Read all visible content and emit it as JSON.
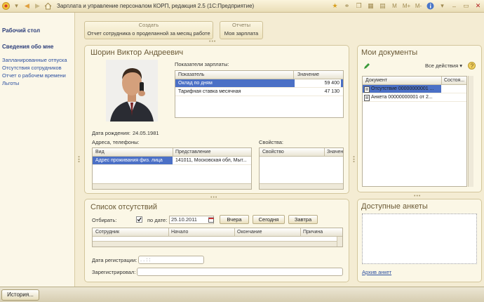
{
  "window": {
    "title": "Зарплата и управление персоналом КОРП, редакция 2.5  (1С:Предприятие)"
  },
  "sidebar": {
    "title1": "Рабочий стол",
    "title2": "Сведения обо мне",
    "items": [
      "Запланированные отпуска",
      "Отсутствия сотрудников",
      "Отчет о рабочем времени",
      "Льготы"
    ]
  },
  "commands": {
    "create_caption": "Создать",
    "create_button": "Отчет сотрудника о проделанной за месяц работе",
    "reports_caption": "Отчеты",
    "reports_button": "Моя зарплата"
  },
  "employee": {
    "name": "Шорин Виктор Андреевич",
    "birth_label": "Дата рождения:",
    "birth_value": "24.05.1981",
    "salary_label": "Показатели зарплаты:",
    "salary_headers": [
      "Показатель",
      "Значение"
    ],
    "salary_rows": [
      {
        "name": "Оклад по дням",
        "value": "59 400"
      },
      {
        "name": "Тарифная ставка месячная",
        "value": "47 130"
      }
    ],
    "addr_label": "Адреса, телефоны:",
    "addr_headers": [
      "Вид",
      "Представление"
    ],
    "addr_rows": [
      {
        "kind": "Адрес проживания физ. лица",
        "repr": "141011, Московская обл, Мыт..."
      }
    ],
    "props_label": "Свойства:",
    "props_headers": [
      "Свойство",
      "Значен"
    ]
  },
  "documents": {
    "title": "Мои документы",
    "all_actions": "Все действия",
    "headers": [
      "Документ",
      "Состоя..."
    ],
    "rows": [
      "Отсутствие 00000000001 ...",
      "Анкета 00000000001 от 2..."
    ]
  },
  "absences": {
    "title": "Список отсутствий",
    "filter_label": "Отбирать:",
    "by_date_label": "по дате:",
    "date_value": "25.10.2011",
    "btn_yesterday": "Вчера",
    "btn_today": "Сегодня",
    "btn_tomorrow": "Завтра",
    "headers": [
      "Сотрудник",
      "Начало",
      "Окончание",
      "Причина"
    ],
    "reg_date_label": "Дата регистрации:",
    "reg_date_value": ". .    : :",
    "registered_label": "Зарегистрировал:"
  },
  "surveys": {
    "title": "Доступные анкеты",
    "archive_link": "Архив анкет"
  },
  "status": {
    "history_button": "История..."
  }
}
